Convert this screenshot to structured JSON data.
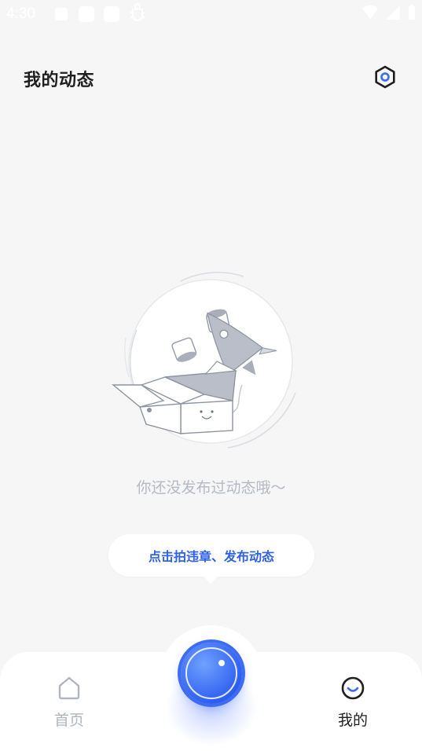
{
  "status_bar": {
    "time": "4:30"
  },
  "header": {
    "title": "我的动态"
  },
  "empty_state": {
    "message": "你还没发布过动态哦～"
  },
  "tooltip": {
    "text": "点击拍违章、发布动态"
  },
  "tabbar": {
    "tabs": [
      {
        "label": "首页",
        "icon": "home-icon",
        "active": false
      },
      {
        "label": "我的",
        "icon": "smiley-icon",
        "active": true
      }
    ],
    "center_button_icon": "camera-icon"
  },
  "colors": {
    "background": "#f6f6f6",
    "accent": "#2e62e6",
    "inactive_text": "#b0b5bf",
    "empty_text": "#b4b9c4"
  }
}
